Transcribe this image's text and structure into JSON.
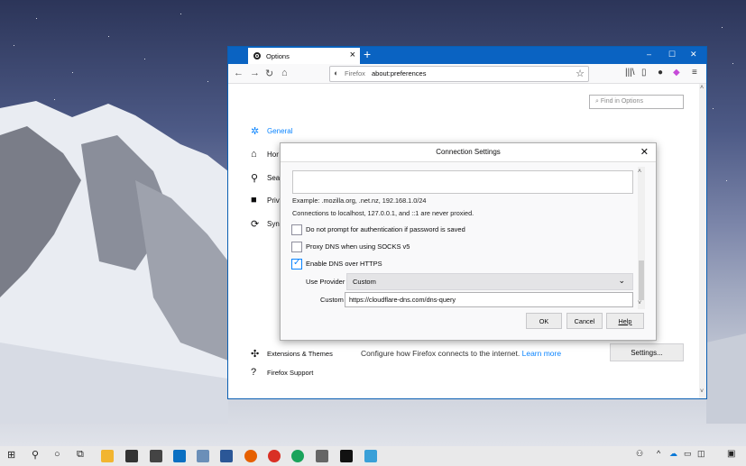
{
  "colors": {
    "accent": "#0a84ff",
    "titlebar": "#0a63c2"
  },
  "browser": {
    "tab_title": "Options",
    "url_label": "Firefox",
    "url": "about:preferences",
    "find_placeholder": "Find in Options"
  },
  "sidebar": {
    "items": [
      {
        "label": "General",
        "icon": "gear-icon"
      },
      {
        "label": "Hor",
        "icon": "home-icon"
      },
      {
        "label": "Sea",
        "icon": "search-icon"
      },
      {
        "label": "Priv",
        "icon": "lock-icon"
      },
      {
        "label": "Syn",
        "icon": "sync-icon"
      }
    ],
    "extensions": "Extensions & Themes",
    "support": "Firefox Support"
  },
  "main": {
    "configure_text": "Configure how Firefox connects to the internet.",
    "learn_more": "Learn more",
    "settings_button": "Settings..."
  },
  "dialog": {
    "title": "Connection Settings",
    "example": "Example: .mozilla.org, .net.nz, 192.168.1.0/24",
    "localhost_note": "Connections to localhost, 127.0.0.1, and ::1 are never proxied.",
    "opt_no_auth": "Do not prompt for authentication if password is saved",
    "opt_proxy_dns": "Proxy DNS when using SOCKS v5",
    "opt_doh": "Enable DNS over HTTPS",
    "opt_no_auth_checked": false,
    "opt_proxy_dns_checked": false,
    "opt_doh_checked": true,
    "use_provider_label": "Use Provider",
    "provider_value": "Custom",
    "custom_label": "Custom",
    "custom_value": "https://cloudflare-dns.com/dns-query",
    "ok": "OK",
    "cancel": "Cancel",
    "help": "Help"
  }
}
